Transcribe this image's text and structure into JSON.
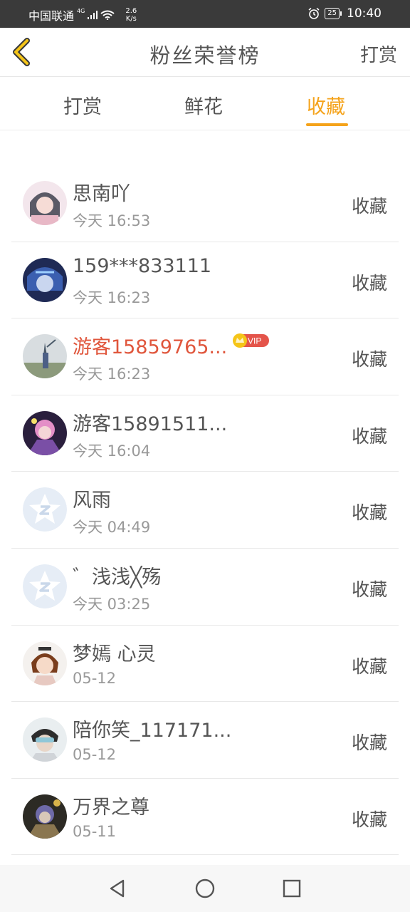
{
  "status_bar": {
    "carrier": "中国联通",
    "network": "4G",
    "speed": "2.6 K/s",
    "battery": "25",
    "time": "10:40"
  },
  "header": {
    "title": "粉丝荣誉榜",
    "right_label": "打赏"
  },
  "tabs": [
    {
      "label": "打赏",
      "active": false
    },
    {
      "label": "鲜花",
      "active": false
    },
    {
      "label": "收藏",
      "active": true
    }
  ],
  "accent_color": "#f5a31a",
  "fans": [
    {
      "name": "思南吖",
      "time": "今天 16:53",
      "action": "收藏",
      "vip": false
    },
    {
      "name": "159***833111",
      "time": "今天 16:23",
      "action": "收藏",
      "vip": false
    },
    {
      "name": "游客15859765...",
      "time": "今天 16:23",
      "action": "收藏",
      "vip": true
    },
    {
      "name": "游客15891511...",
      "time": "今天 16:04",
      "action": "收藏",
      "vip": false
    },
    {
      "name": "风雨",
      "time": "今天 04:49",
      "action": "收藏",
      "vip": false
    },
    {
      "name": "゛浅浅╳殇",
      "time": "今天 03:25",
      "action": "收藏",
      "vip": false
    },
    {
      "name": "梦嫣 心灵",
      "time": "05-12",
      "action": "收藏",
      "vip": false
    },
    {
      "name": "陪你笑_117171...",
      "time": "05-12",
      "action": "收藏",
      "vip": false
    },
    {
      "name": "万界之尊",
      "time": "05-11",
      "action": "收藏",
      "vip": false
    }
  ],
  "vip_badge": "VIP",
  "nav": {
    "back_icon": "back-triangle-icon",
    "home_icon": "home-circle-icon",
    "recents_icon": "recents-square-icon"
  }
}
